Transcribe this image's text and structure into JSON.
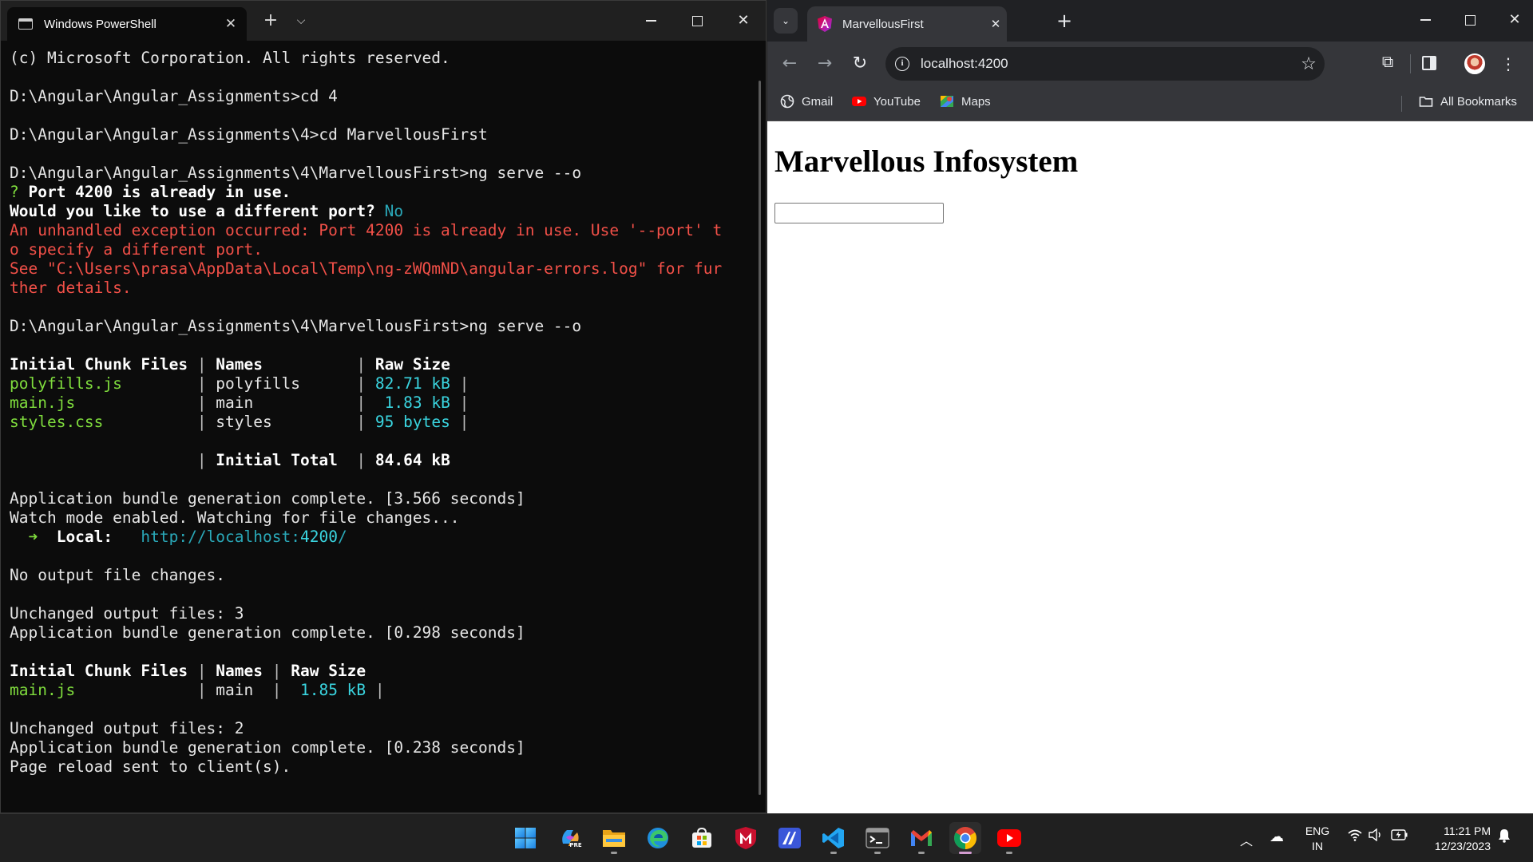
{
  "terminal": {
    "tab_title": "Windows PowerShell",
    "tab_close": "✕",
    "new_tab": "+",
    "dropdown": "⌵",
    "lines": [
      [
        {
          "t": "(c) Microsoft Corporation. All rights reserved.",
          "c": ""
        }
      ],
      [],
      [
        {
          "t": "D:\\Angular\\Angular_Assignments>cd 4",
          "c": ""
        }
      ],
      [],
      [
        {
          "t": "D:\\Angular\\Angular_Assignments\\4>cd MarvellousFirst",
          "c": ""
        }
      ],
      [],
      [
        {
          "t": "D:\\Angular\\Angular_Assignments\\4\\MarvellousFirst>ng serve --o",
          "c": ""
        }
      ],
      [
        {
          "t": "? ",
          "c": "green"
        },
        {
          "t": "Port 4200 is already in use.",
          "c": "bold"
        }
      ],
      [
        {
          "t": "Would you like to use a different port? ",
          "c": "bold"
        },
        {
          "t": "No",
          "c": "teal"
        }
      ],
      [
        {
          "t": "An unhandled exception occurred: Port 4200 is already in use. Use '--port' t",
          "c": "red"
        }
      ],
      [
        {
          "t": "o specify a different port.",
          "c": "red"
        }
      ],
      [
        {
          "t": "See \"C:\\Users\\prasa\\AppData\\Local\\Temp\\ng-zWQmND\\angular-errors.log\" for fur",
          "c": "red"
        }
      ],
      [
        {
          "t": "ther details.",
          "c": "red"
        }
      ],
      [],
      [
        {
          "t": "D:\\Angular\\Angular_Assignments\\4\\MarvellousFirst>ng serve --o",
          "c": ""
        }
      ],
      [],
      [
        {
          "t": "Initial Chunk Files ",
          "c": "bold"
        },
        {
          "t": "| ",
          "c": "dim"
        },
        {
          "t": "Names          ",
          "c": "bold"
        },
        {
          "t": "| ",
          "c": "dim"
        },
        {
          "t": "Raw Size",
          "c": "bold"
        }
      ],
      [
        {
          "t": "polyfills.js        ",
          "c": "green"
        },
        {
          "t": "| ",
          "c": "dim"
        },
        {
          "t": "polyfills      ",
          "c": ""
        },
        {
          "t": "| ",
          "c": "dim"
        },
        {
          "t": "82.71 kB ",
          "c": "cyan"
        },
        {
          "t": "|",
          "c": "dim"
        }
      ],
      [
        {
          "t": "main.js             ",
          "c": "green"
        },
        {
          "t": "| ",
          "c": "dim"
        },
        {
          "t": "main           ",
          "c": ""
        },
        {
          "t": "| ",
          "c": "dim"
        },
        {
          "t": " 1.83 kB ",
          "c": "cyan"
        },
        {
          "t": "|",
          "c": "dim"
        }
      ],
      [
        {
          "t": "styles.css          ",
          "c": "green"
        },
        {
          "t": "| ",
          "c": "dim"
        },
        {
          "t": "styles         ",
          "c": ""
        },
        {
          "t": "| ",
          "c": "dim"
        },
        {
          "t": "95 bytes ",
          "c": "cyan"
        },
        {
          "t": "|",
          "c": "dim"
        }
      ],
      [],
      [
        {
          "t": "                    ",
          "c": ""
        },
        {
          "t": "| ",
          "c": "dim"
        },
        {
          "t": "Initial Total  ",
          "c": "bold"
        },
        {
          "t": "| ",
          "c": "dim"
        },
        {
          "t": "84.64 kB",
          "c": "bold"
        }
      ],
      [],
      [
        {
          "t": "Application bundle generation complete. [3.566 seconds]",
          "c": ""
        }
      ],
      [
        {
          "t": "Watch mode enabled. Watching for file changes...",
          "c": ""
        }
      ],
      [
        {
          "t": "  ➜  ",
          "c": "green"
        },
        {
          "t": "Local:",
          "c": "bold"
        },
        {
          "t": "   ",
          "c": ""
        },
        {
          "t": "http://localhost:",
          "c": "teal"
        },
        {
          "t": "4200",
          "c": "cyan"
        },
        {
          "t": "/",
          "c": "teal"
        }
      ],
      [],
      [
        {
          "t": "No output file changes.",
          "c": ""
        }
      ],
      [],
      [
        {
          "t": "Unchanged output files: 3",
          "c": ""
        }
      ],
      [
        {
          "t": "Application bundle generation complete. [0.298 seconds]",
          "c": ""
        }
      ],
      [],
      [
        {
          "t": "Initial Chunk Files ",
          "c": "bold"
        },
        {
          "t": "| ",
          "c": "dim"
        },
        {
          "t": "Names ",
          "c": "bold"
        },
        {
          "t": "| ",
          "c": "dim"
        },
        {
          "t": "Raw Size",
          "c": "bold"
        }
      ],
      [
        {
          "t": "main.js             ",
          "c": "green"
        },
        {
          "t": "| ",
          "c": "dim"
        },
        {
          "t": "main  ",
          "c": ""
        },
        {
          "t": "| ",
          "c": "dim"
        },
        {
          "t": " 1.85 kB ",
          "c": "cyan"
        },
        {
          "t": "|",
          "c": "dim"
        }
      ],
      [],
      [
        {
          "t": "Unchanged output files: 2",
          "c": ""
        }
      ],
      [
        {
          "t": "Application bundle generation complete. [0.238 seconds]",
          "c": ""
        }
      ],
      [
        {
          "t": "Page reload sent to client(s).",
          "c": ""
        }
      ]
    ]
  },
  "browser": {
    "tab_title": "MarvellousFirst",
    "tab_close": "✕",
    "new_tab": "+",
    "url": "localhost:4200",
    "bookmarks": {
      "gmail": "Gmail",
      "youtube": "YouTube",
      "maps": "Maps",
      "all": "All Bookmarks"
    },
    "page": {
      "heading": "Marvellous Infosystem",
      "input_value": ""
    }
  },
  "taskbar": {
    "apps": [
      "start-icon",
      "copilot-icon",
      "file-explorer-icon",
      "edge-icon",
      "store-icon",
      "mcafee-icon",
      "notes-icon",
      "vscode-icon",
      "terminal-icon",
      "gmail-icon",
      "chrome-icon",
      "youtube-icon"
    ],
    "lang_top": "ENG",
    "lang_bottom": "IN",
    "time": "11:21 PM",
    "date": "12/23/2023"
  },
  "colors": {
    "terminal_bg": "#0c0c0c",
    "error_red": "#f25048",
    "file_green": "#7fdc3d",
    "size_cyan": "#3ad5e0",
    "chrome_dark": "#35363a"
  }
}
